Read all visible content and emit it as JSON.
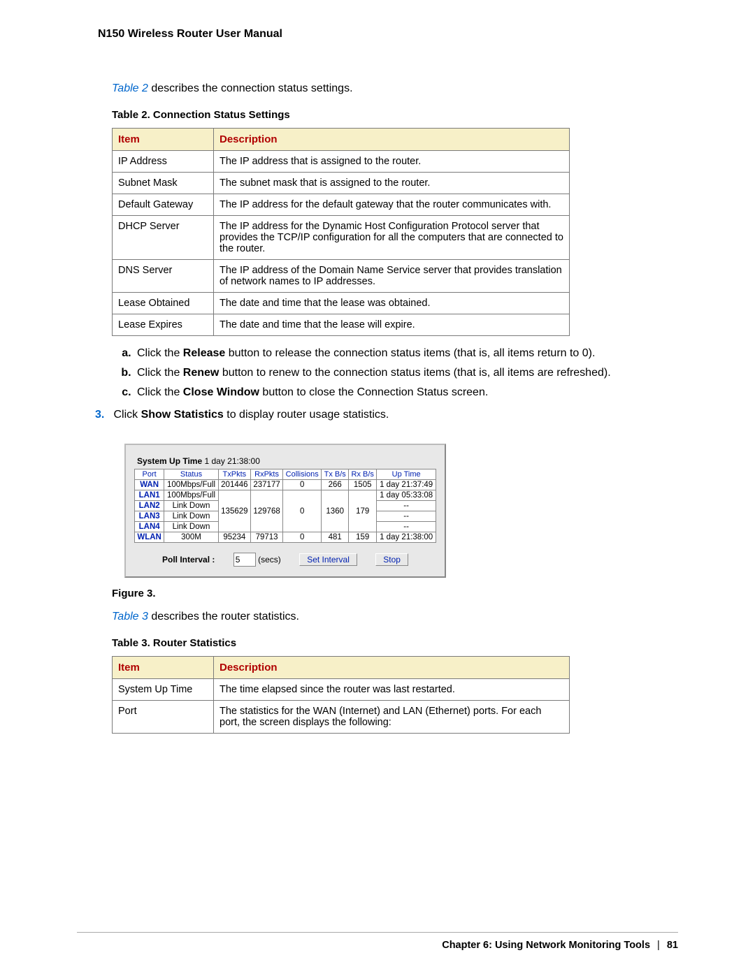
{
  "header": {
    "doc_title": "N150 Wireless Router User Manual"
  },
  "intro1_prefix": "Table 2",
  "intro1_rest": " describes the connection status settings.",
  "table2": {
    "title": "Table 2.  Connection Status Settings",
    "h_item": "Item",
    "h_desc": "Description",
    "rows": [
      {
        "item": "IP Address",
        "desc": "The IP address that is assigned to the router."
      },
      {
        "item": "Subnet Mask",
        "desc": "The subnet mask that is assigned to the router."
      },
      {
        "item": "Default Gateway",
        "desc": "The IP address for the default gateway that the router communicates with."
      },
      {
        "item": "DHCP Server",
        "desc": "The IP address for the Dynamic Host Configuration Protocol server that provides the TCP/IP configuration for all the computers that are connected to the router."
      },
      {
        "item": "DNS Server",
        "desc": "The IP address of the Domain Name Service server that provides translation of network names to IP addresses."
      },
      {
        "item": "Lease Obtained",
        "desc": "The date and time that the lease was obtained."
      },
      {
        "item": "Lease Expires",
        "desc": "The date and time that the lease will expire."
      }
    ]
  },
  "steps": {
    "a_pre": "Click the ",
    "a_bold": "Release",
    "a_post": " button to release the connection status items (that is, all items return to 0).",
    "b_pre": "Click the ",
    "b_bold": "Renew",
    "b_post": " button to renew to the connection status items (that is, all items are refreshed).",
    "c_pre": "Click the ",
    "c_bold": "Close Window",
    "c_post": " button to close the Connection Status screen.",
    "s3_num": "3.",
    "s3_pre": "Click ",
    "s3_bold": "Show Statistics",
    "s3_post": " to display router usage statistics."
  },
  "stats_panel": {
    "uptime_label": "System Up Time",
    "uptime_value": " 1 day 21:38:00",
    "cols": {
      "port": "Port",
      "status": "Status",
      "tx": "TxPkts",
      "rx": "RxPkts",
      "col": "Collisions",
      "txbs": "Tx B/s",
      "rxbs": "Rx B/s",
      "up": "Up Time"
    },
    "wan": {
      "port": "WAN",
      "status": "100Mbps/Full",
      "tx": "201446",
      "rx": "237177",
      "col": "0",
      "txbs": "266",
      "rxbs": "1505",
      "up": "1 day 21:37:49"
    },
    "lan1": {
      "port": "LAN1",
      "status": "100Mbps/Full",
      "up": "1 day 05:33:08"
    },
    "lan2": {
      "port": "LAN2",
      "status": "Link Down",
      "up": "--"
    },
    "lan3": {
      "port": "LAN3",
      "status": "Link Down",
      "up": "--"
    },
    "lan4": {
      "port": "LAN4",
      "status": "Link Down",
      "up": "--"
    },
    "lan_shared": {
      "tx": "135629",
      "rx": "129768",
      "col": "0",
      "txbs": "1360",
      "rxbs": "179"
    },
    "wlan": {
      "port": "WLAN",
      "status": "300M",
      "tx": "95234",
      "rx": "79713",
      "col": "0",
      "txbs": "481",
      "rxbs": "159",
      "up": "1 day 21:38:00"
    },
    "poll_label": "Poll Interval :",
    "poll_value": "5",
    "poll_unit": "(secs)",
    "btn_set": "Set Interval",
    "btn_stop": "Stop"
  },
  "figure_caption": "Figure 3.",
  "intro3_prefix": "Table 3",
  "intro3_rest": " describes the router statistics.",
  "table3": {
    "title": "Table 3.  Router Statistics",
    "h_item": "Item",
    "h_desc": "Description",
    "rows": [
      {
        "item": "System Up Time",
        "desc": "The time elapsed since the router was last restarted."
      },
      {
        "item": "Port",
        "desc": "The statistics for the WAN (Internet) and LAN (Ethernet) ports. For each port, the screen displays the following:"
      }
    ]
  },
  "footer": {
    "chapter": "Chapter 6:  Using Network Monitoring Tools",
    "sep": "|",
    "page": "81"
  }
}
